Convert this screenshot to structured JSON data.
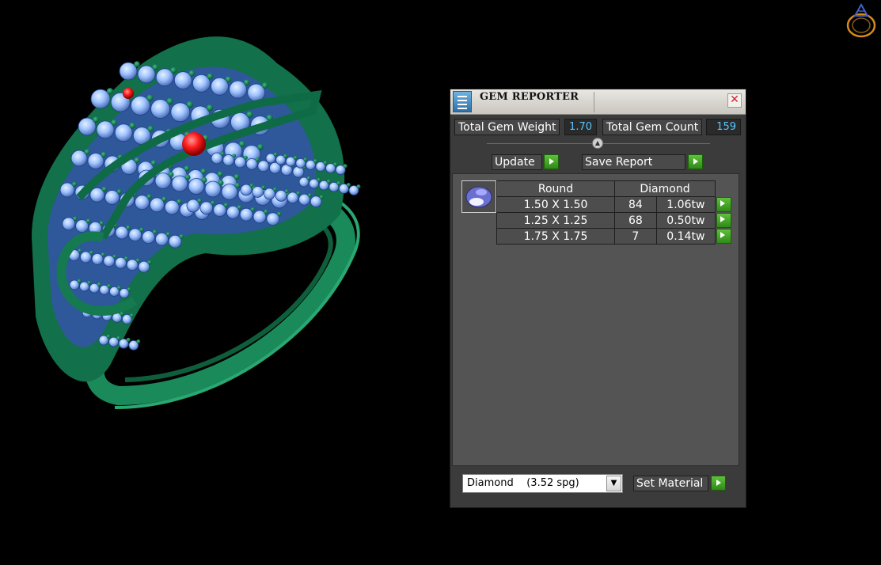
{
  "window": {
    "title": "GEM REPORTER"
  },
  "totals": {
    "weight_label": "Total Gem Weight",
    "weight_value": "1.70",
    "count_label": "Total Gem Count",
    "count_value": "159"
  },
  "actions": {
    "update_label": "Update",
    "save_report_label": "Save Report",
    "set_material_label": "Set Material"
  },
  "gem_table": {
    "headers": [
      "Round",
      "Diamond"
    ],
    "rows": [
      {
        "size": "1.50 X 1.50",
        "count": "84",
        "weight": "1.06tw"
      },
      {
        "size": "1.25 X 1.25",
        "count": "68",
        "weight": "0.50tw"
      },
      {
        "size": "1.75 X 1.75",
        "count": "7",
        "weight": "0.14tw"
      }
    ]
  },
  "material": {
    "selected": "Diamond    (3.52 spg)"
  },
  "colors": {
    "accent_value": "#56c7ff",
    "go_button": "#3fa822",
    "ring_metal": "#1d8a5c",
    "gem_stone": "#9ec4ff",
    "eye_stone": "#e01010"
  }
}
